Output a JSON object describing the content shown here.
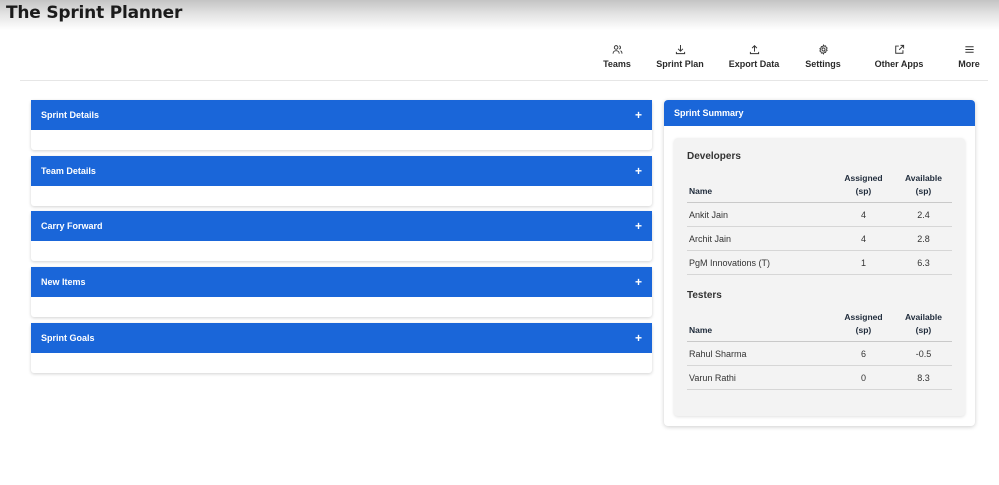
{
  "app": {
    "title": "The Sprint Planner"
  },
  "nav": [
    {
      "label": "Teams",
      "icon": "users-icon"
    },
    {
      "label": "Sprint Plan",
      "icon": "download-icon"
    },
    {
      "label": "Export Data",
      "icon": "upload-icon"
    },
    {
      "label": "Settings",
      "icon": "gear-icon"
    },
    {
      "label": "Other Apps",
      "icon": "external-link-icon"
    },
    {
      "label": "More",
      "icon": "menu-icon"
    }
  ],
  "sections": [
    {
      "title": "Sprint Details",
      "toggle": "+"
    },
    {
      "title": "Team Details",
      "toggle": "+"
    },
    {
      "title": "Carry Forward",
      "toggle": "+"
    },
    {
      "title": "New Items",
      "toggle": "+"
    },
    {
      "title": "Sprint Goals",
      "toggle": "+"
    }
  ],
  "summary": {
    "title": "Sprint Summary",
    "headers": {
      "name": "Name",
      "assigned": "Assigned",
      "assigned_unit": "(sp)",
      "available": "Available",
      "available_unit": "(sp)"
    },
    "developers": {
      "title": "Developers",
      "rows": [
        {
          "name": "Ankit Jain",
          "assigned": "4",
          "available": "2.4"
        },
        {
          "name": "Archit Jain",
          "assigned": "4",
          "available": "2.8"
        },
        {
          "name": "PgM Innovations (T)",
          "assigned": "1",
          "available": "6.3"
        }
      ]
    },
    "testers": {
      "title": "Testers",
      "rows": [
        {
          "name": "Rahul Sharma",
          "assigned": "6",
          "available": "-0.5"
        },
        {
          "name": "Varun Rathi",
          "assigned": "0",
          "available": "8.3"
        }
      ]
    }
  },
  "colors": {
    "accent": "#1a66d9",
    "positive": "#2a8a2a",
    "negative": "#d32222"
  }
}
